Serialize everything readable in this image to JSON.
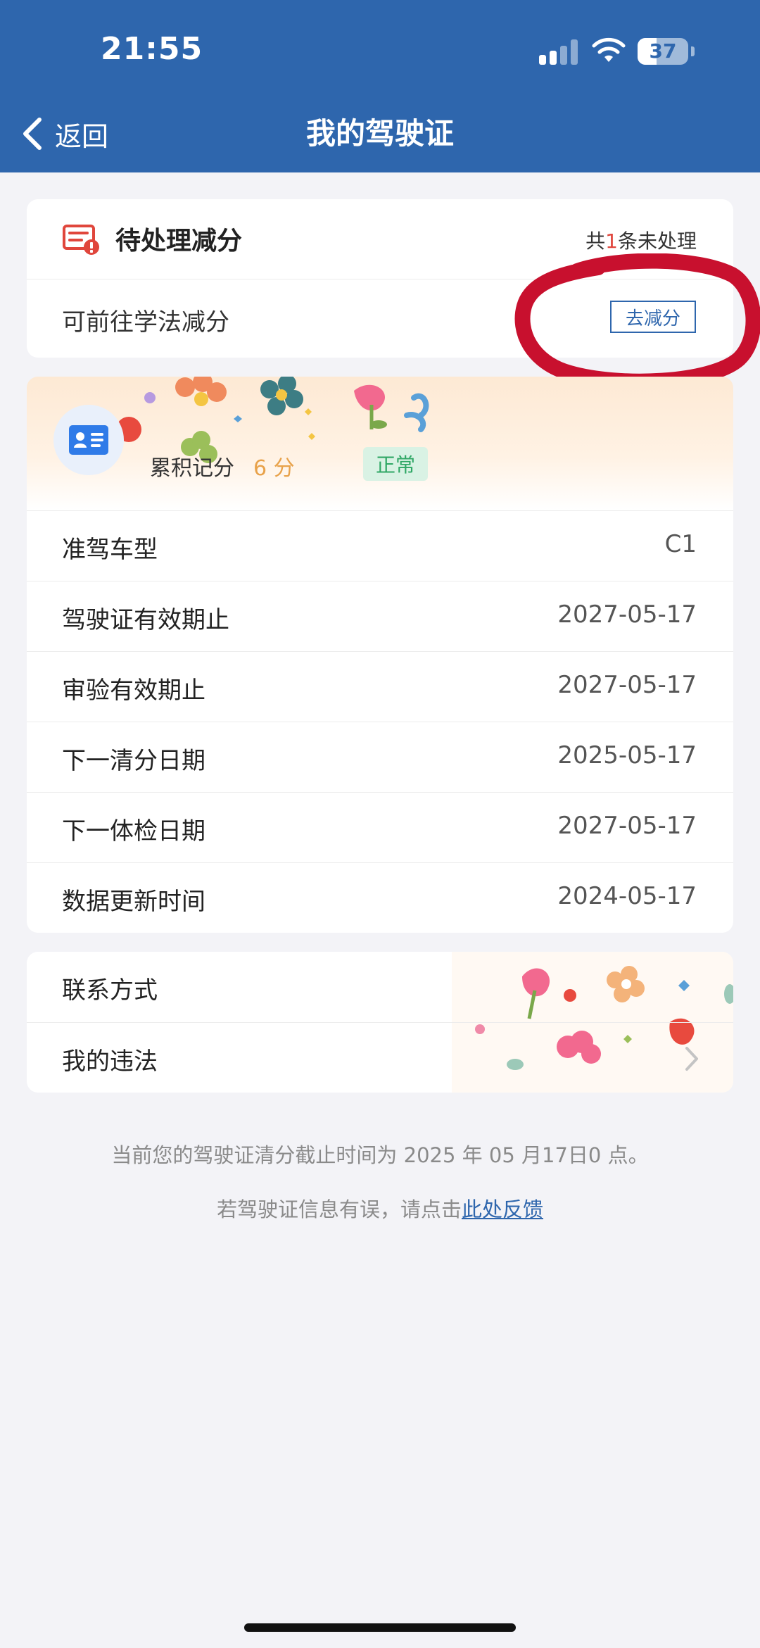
{
  "status_bar": {
    "time": "21:55",
    "battery_level": "37",
    "battery_fraction": 0.37
  },
  "nav": {
    "back_label": "返回",
    "title": "我的驾驶证"
  },
  "pending": {
    "title": "待处理减分",
    "count_prefix": "共",
    "count": "1",
    "count_suffix": "条未处理",
    "row_label": "可前往学法减分",
    "action_label": "去减分"
  },
  "license": {
    "points_label": "累积记分",
    "points_value": "6 分",
    "status": "正常"
  },
  "info_rows": [
    {
      "label": "准驾车型",
      "value": "C1"
    },
    {
      "label": "驾驶证有效期止",
      "value": "2027-05-17"
    },
    {
      "label": "审验有效期止",
      "value": "2027-05-17"
    },
    {
      "label": "下一清分日期",
      "value": "2025-05-17"
    },
    {
      "label": "下一体检日期",
      "value": "2027-05-17"
    },
    {
      "label": "数据更新时间",
      "value": "2024-05-17"
    }
  ],
  "links": [
    {
      "label": "联系方式"
    },
    {
      "label": "我的违法"
    }
  ],
  "footer": {
    "note": "当前您的驾驶证清分截止时间为 2025 年 05 月17日0 点。",
    "feedback_prefix": "若驾驶证信息有误，请点击",
    "feedback_link": "此处反馈"
  },
  "colors": {
    "header_blue": "#2e66ad",
    "accent_red": "#e0463c",
    "points_orange": "#e8a24a",
    "status_green": "#2fa765",
    "annotation_red": "#c8102e"
  }
}
